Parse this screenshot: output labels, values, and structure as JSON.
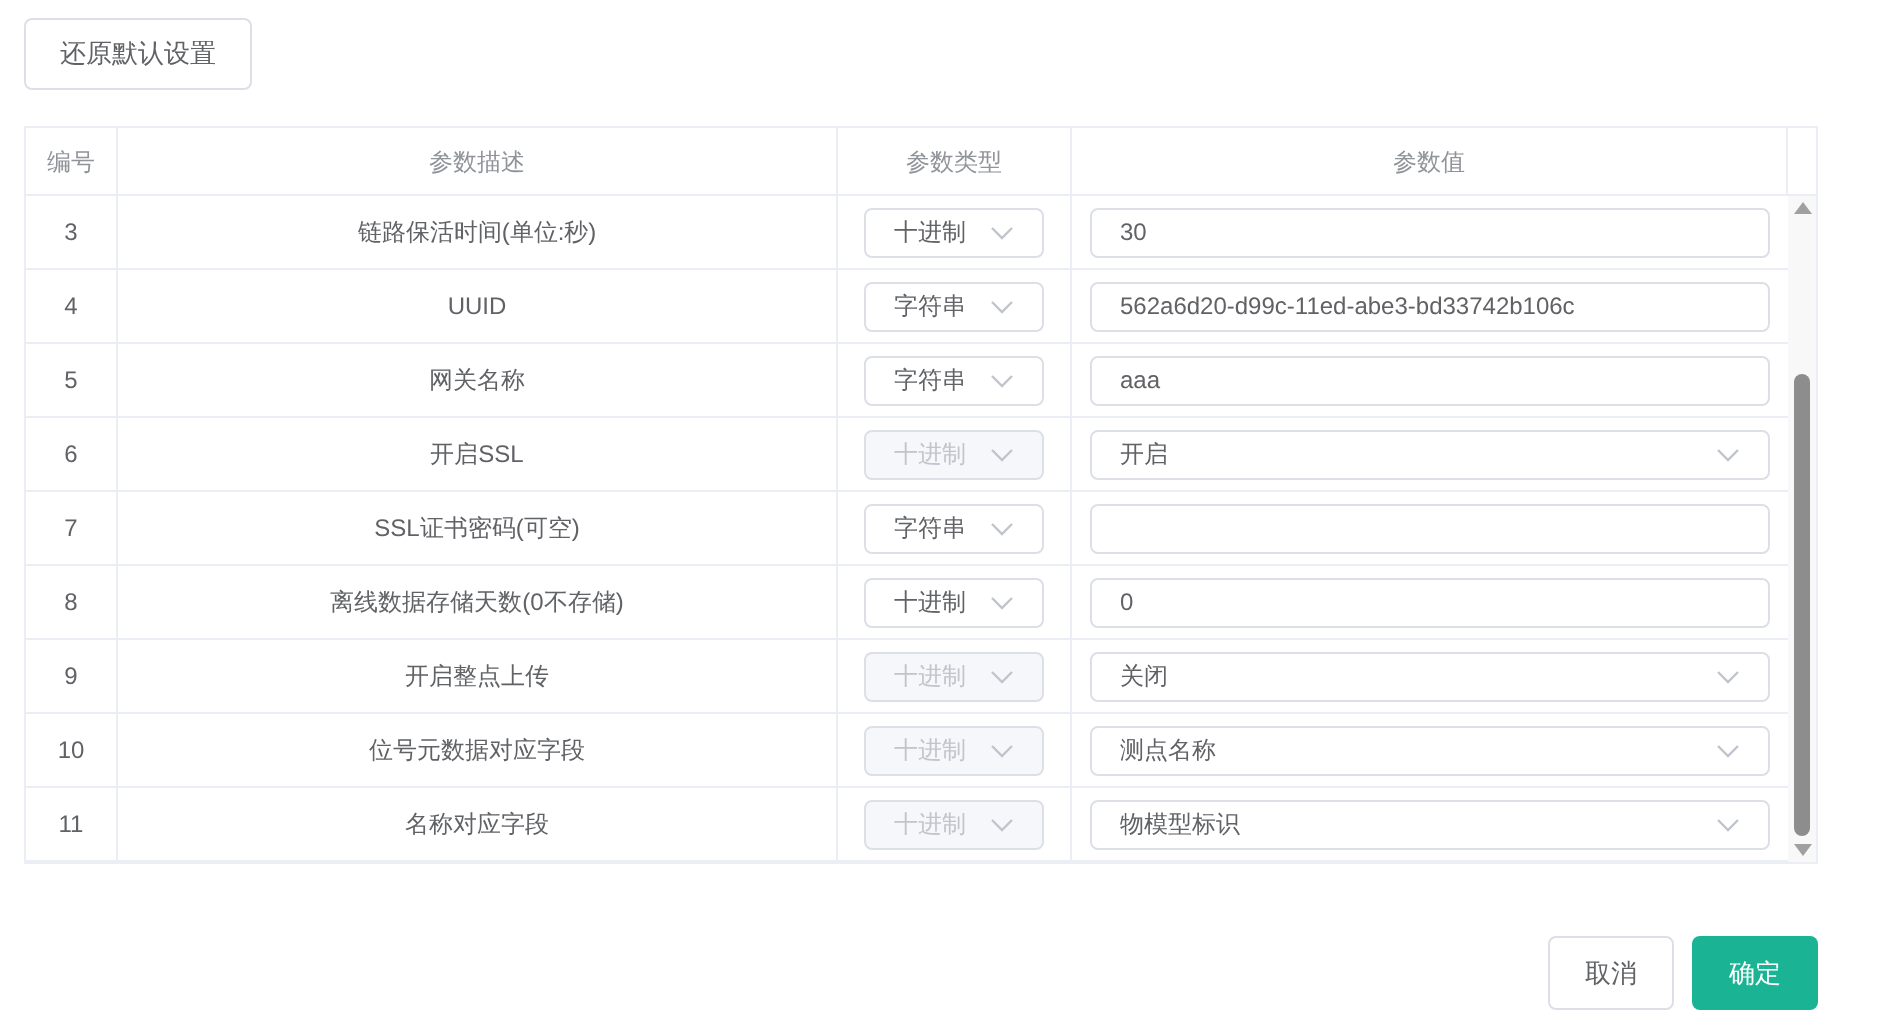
{
  "reset_button": "还原默认设置",
  "table": {
    "columns": [
      "编号",
      "参数描述",
      "参数类型",
      "参数值"
    ],
    "rows": [
      {
        "number": "3",
        "description": "链路保活时间(单位:秒)",
        "type": "十进制",
        "type_disabled": false,
        "kind": "input",
        "value": "30"
      },
      {
        "number": "4",
        "description": "UUID",
        "type": "字符串",
        "type_disabled": false,
        "kind": "input",
        "value": "562a6d20-d99c-11ed-abe3-bd33742b106c"
      },
      {
        "number": "5",
        "description": "网关名称",
        "type": "字符串",
        "type_disabled": false,
        "kind": "input",
        "value": "aaa"
      },
      {
        "number": "6",
        "description": "开启SSL",
        "type": "十进制",
        "type_disabled": true,
        "kind": "select",
        "value": "开启"
      },
      {
        "number": "7",
        "description": "SSL证书密码(可空)",
        "type": "字符串",
        "type_disabled": false,
        "kind": "input"
      },
      {
        "number": "8",
        "description": "离线数据存储天数(0不存储)",
        "type": "十进制",
        "type_disabled": false,
        "kind": "input",
        "value": "0"
      },
      {
        "number": "9",
        "description": "开启整点上传",
        "type": "十进制",
        "type_disabled": true,
        "kind": "select",
        "value": "关闭"
      },
      {
        "number": "10",
        "description": "位号元数据对应字段",
        "type": "十进制",
        "type_disabled": true,
        "kind": "select",
        "value": "测点名称"
      },
      {
        "number": "11",
        "description": "名称对应字段",
        "type": "十进制",
        "type_disabled": true,
        "kind": "select",
        "value": "物模型标识"
      }
    ]
  },
  "footer_buttons": [
    {
      "label": "取消",
      "kind": "secondary"
    },
    {
      "label": "确定",
      "kind": "primary"
    }
  ]
}
